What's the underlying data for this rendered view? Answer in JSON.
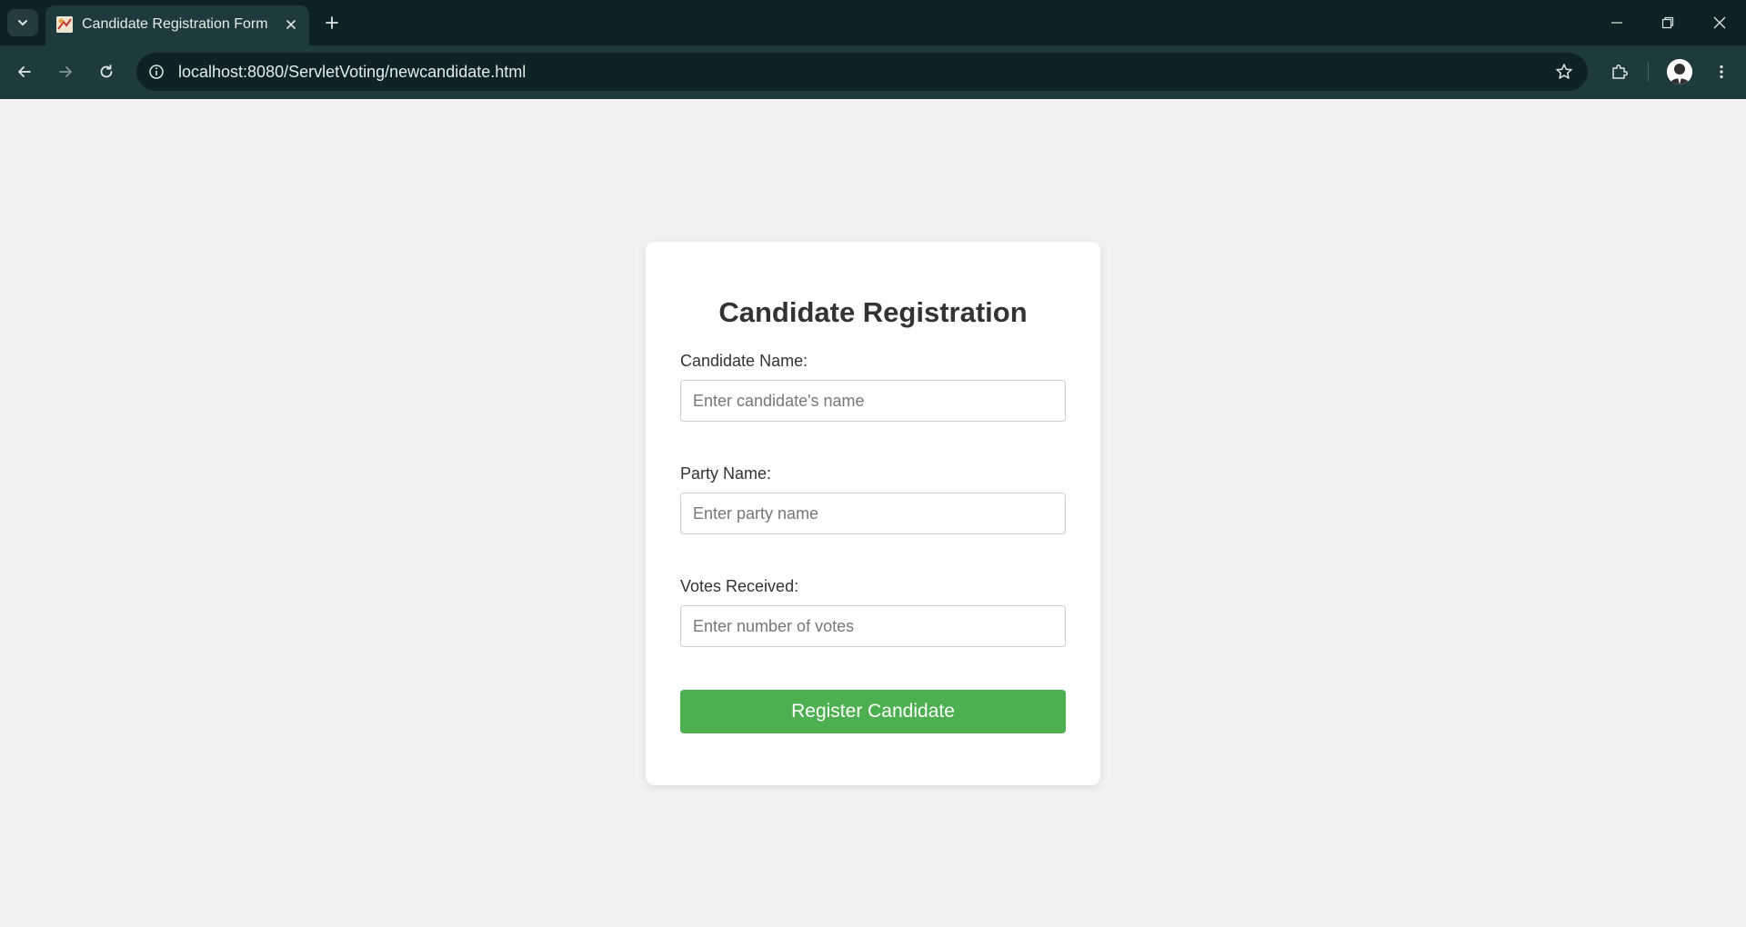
{
  "browser": {
    "tab_title": "Candidate Registration Form",
    "url": "localhost:8080/ServletVoting/newcandidate.html"
  },
  "form": {
    "title": "Candidate Registration",
    "fields": [
      {
        "label": "Candidate Name:",
        "placeholder": "Enter candidate's name",
        "value": ""
      },
      {
        "label": "Party Name:",
        "placeholder": "Enter party name",
        "value": ""
      },
      {
        "label": "Votes Received:",
        "placeholder": "Enter number of votes",
        "value": ""
      }
    ],
    "submit_label": "Register Candidate"
  },
  "colors": {
    "page_background": "#f2f2f2",
    "card_background": "#ffffff",
    "submit_button": "#4caf50",
    "browser_frame": "#0d2226",
    "browser_toolbar": "#1f3a3f"
  }
}
